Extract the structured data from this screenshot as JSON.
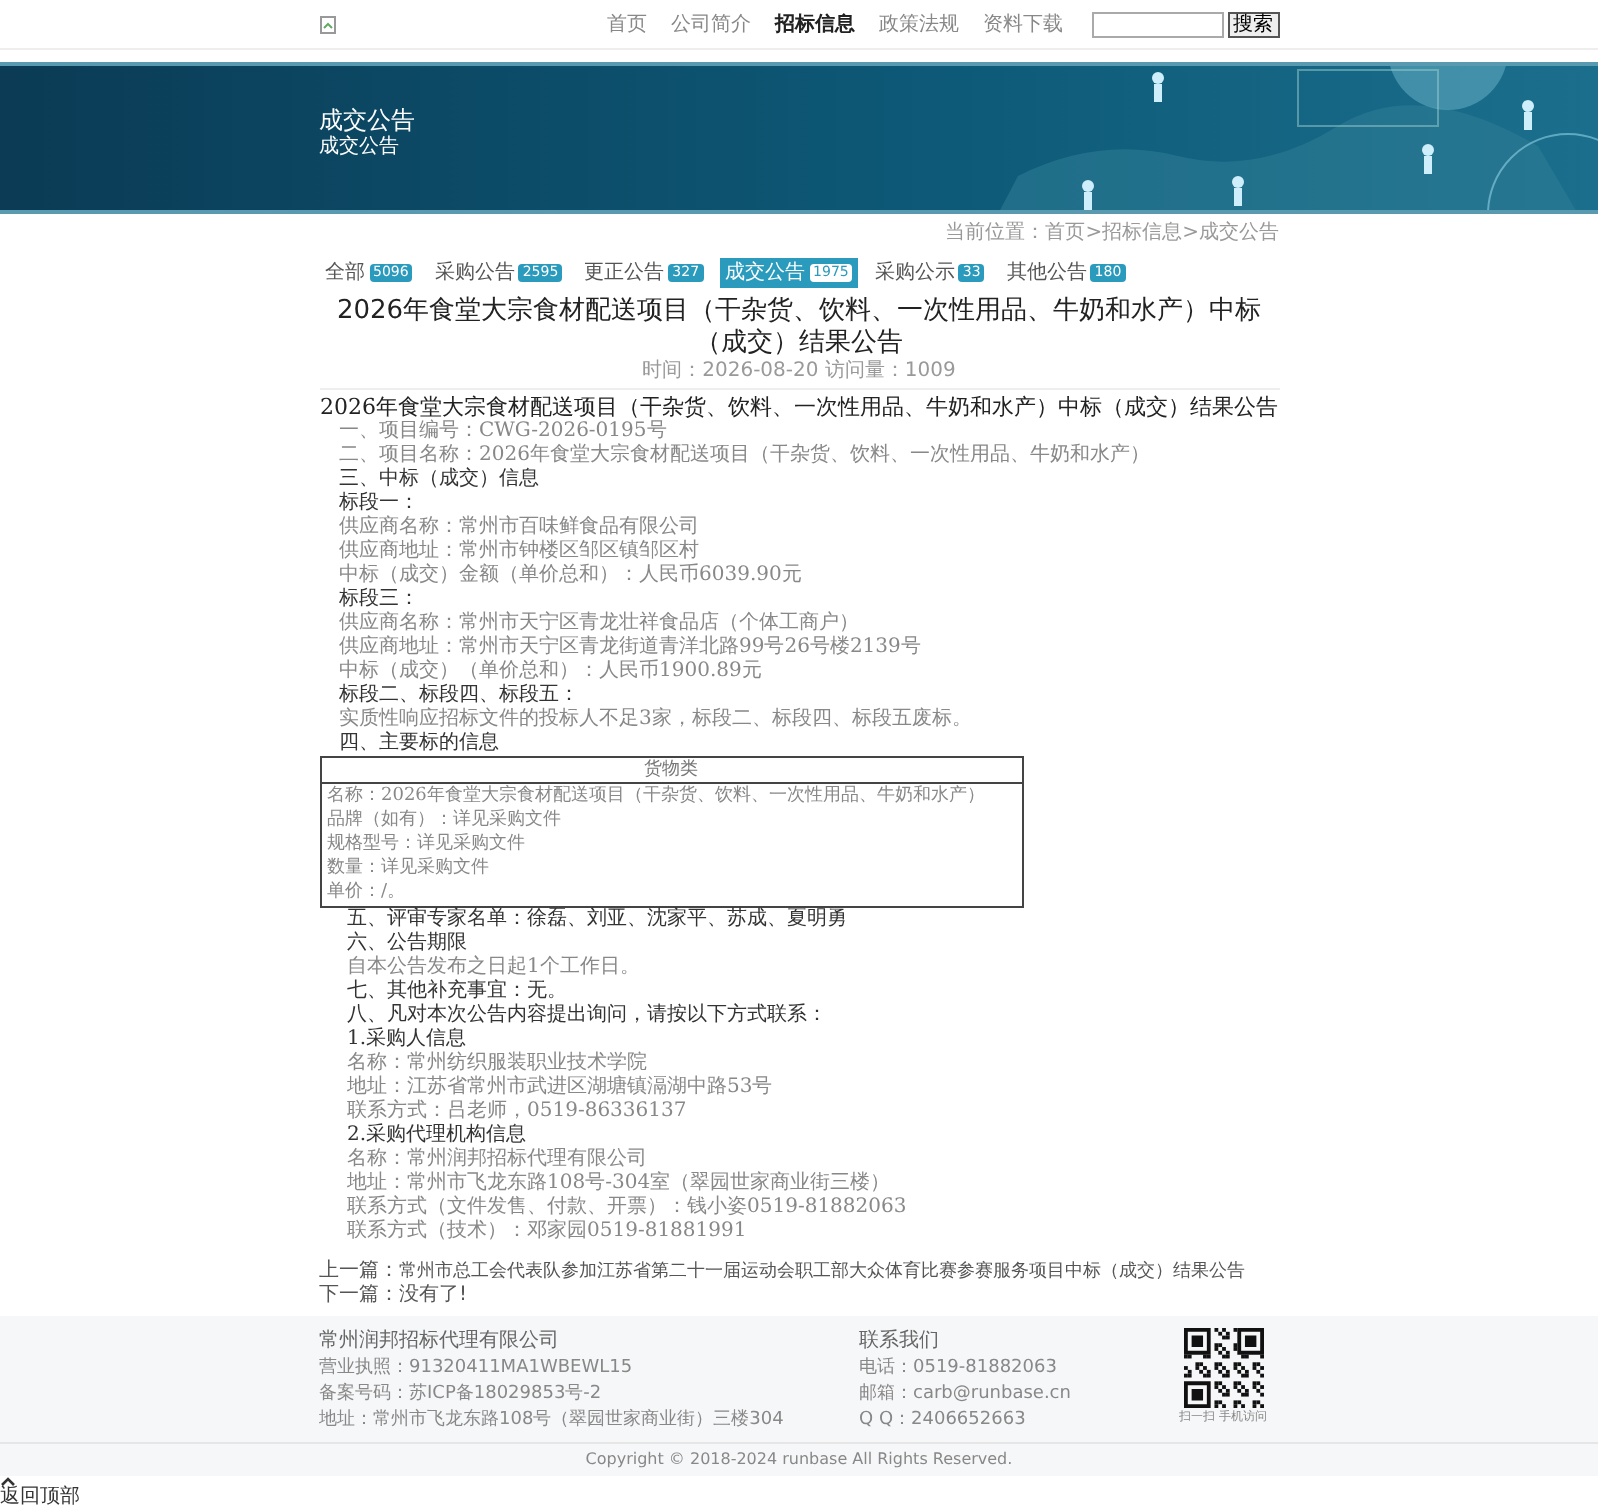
{
  "header": {
    "nav": [
      {
        "label": "首页",
        "selected": false
      },
      {
        "label": "公司简介",
        "selected": false
      },
      {
        "label": "招标信息",
        "selected": true
      },
      {
        "label": "政策法规",
        "selected": false
      },
      {
        "label": "资料下载",
        "selected": false
      }
    ],
    "search_button": "搜索"
  },
  "banner": {
    "title": "成交公告",
    "subtitle": "成交公告"
  },
  "breadcrumb": "当前位置：首页>招标信息>成交公告",
  "tabs": [
    {
      "label": "全部",
      "count": "5096",
      "selected": false
    },
    {
      "label": "采购公告",
      "count": "2595",
      "selected": false
    },
    {
      "label": "更正公告",
      "count": "327",
      "selected": false
    },
    {
      "label": "成交公告",
      "count": "1975",
      "selected": true
    },
    {
      "label": "采购公示",
      "count": "33",
      "selected": false
    },
    {
      "label": "其他公告",
      "count": "180",
      "selected": false
    }
  ],
  "article": {
    "title": "2026年食堂大宗食材配送项目（干杂货、饮料、一次性用品、牛奶和水产）中标（成交）结果公告",
    "meta": "时间：2026-08-20  访问量：1009",
    "lines": [
      {
        "kind": "title",
        "text": "2026年食堂大宗食材配送项目（干杂货、饮料、一次性用品、牛奶和水产）中标（成交）结果公告"
      },
      {
        "kind": "text",
        "text": "一、项目编号：CWG-2026-0195号"
      },
      {
        "kind": "text",
        "text": "二、项目名称：2026年食堂大宗食材配送项目（干杂货、饮料、一次性用品、牛奶和水产）"
      },
      {
        "kind": "heading",
        "text": "三、中标（成交）信息"
      },
      {
        "kind": "heading",
        "text": "标段一："
      },
      {
        "kind": "text",
        "text": "供应商名称：常州市百味鲜食品有限公司"
      },
      {
        "kind": "text",
        "text": "供应商地址：常州市钟楼区邹区镇邹区村"
      },
      {
        "kind": "text",
        "text": "中标（成交）金额（单价总和）：人民币6039.90元"
      },
      {
        "kind": "heading",
        "text": "标段三："
      },
      {
        "kind": "text",
        "text": "供应商名称：常州市天宁区青龙壮祥食品店（个体工商户）"
      },
      {
        "kind": "text",
        "text": "供应商地址：常州市天宁区青龙街道青洋北路99号26号楼2139号"
      },
      {
        "kind": "text",
        "text": "中标（成交）（单价总和）：人民币1900.89元"
      },
      {
        "kind": "heading",
        "text": "标段二、标段四、标段五："
      },
      {
        "kind": "text",
        "text": "实质性响应招标文件的投标人不足3家，标段二、标段四、标段五废标。"
      },
      {
        "kind": "heading",
        "text": "四、主要标的信息"
      }
    ],
    "table": {
      "header": "货物类",
      "rows": [
        "名称：2026年食堂大宗食材配送项目（干杂货、饮料、一次性用品、牛奶和水产）",
        "品牌（如有）：详见采购文件",
        "规格型号：详见采购文件",
        "数量：详见采购文件",
        "单价：/。"
      ]
    },
    "lines_after": [
      {
        "kind": "heading",
        "text": "五、评审专家名单：徐磊、刘亚、沈家平、苏成、夏明勇"
      },
      {
        "kind": "heading",
        "text": "六、公告期限"
      },
      {
        "kind": "text",
        "text": "自本公告发布之日起1个工作日。"
      },
      {
        "kind": "heading",
        "text": "七、其他补充事宜：无。"
      },
      {
        "kind": "heading",
        "text": "八、凡对本次公告内容提出询问，请按以下方式联系："
      },
      {
        "kind": "heading",
        "text": "1.采购人信息"
      },
      {
        "kind": "text",
        "text": "名称：常州纺织服装职业技术学院"
      },
      {
        "kind": "text",
        "text": "地址：江苏省常州市武进区湖塘镇滆湖中路53号"
      },
      {
        "kind": "text",
        "text": "联系方式：吕老师，0519-86336137"
      },
      {
        "kind": "heading",
        "text": "2.采购代理机构信息"
      },
      {
        "kind": "text",
        "text": "名称：常州润邦招标代理有限公司"
      },
      {
        "kind": "text",
        "text": "地址：常州市飞龙东路108号-304室（翠园世家商业街三楼）"
      },
      {
        "kind": "text",
        "text": "联系方式（文件发售、付款、开票）：钱小姿0519-81882063"
      },
      {
        "kind": "text",
        "text": "联系方式（技术）：邓家园0519-81881991"
      }
    ]
  },
  "pager": {
    "prev_label": "上一篇：",
    "prev": "常州市总工会代表队参加江苏省第二十一届运动会职工部大众体育比赛参赛服务项目中标（成交）结果公告",
    "next_label": "下一篇：",
    "next": "没有了!"
  },
  "footer": {
    "company": "常州润邦招标代理有限公司",
    "info": [
      "营业执照：91320411MA1WBEWL15",
      "备案号码：苏ICP备18029853号-2",
      "地址：常州市飞龙东路108号（翠园世家商业街）三楼304"
    ],
    "contact_title": "联系我们",
    "contact": [
      "电话：0519-81882063",
      "邮箱：carb@runbase.cn",
      "Q Q：2406652663"
    ],
    "qr_caption": "扫一扫 手机访问"
  },
  "copyright": "Copyright © 2018-2024 runbase All Rights Reserved.",
  "back_to_top": "返回顶部"
}
